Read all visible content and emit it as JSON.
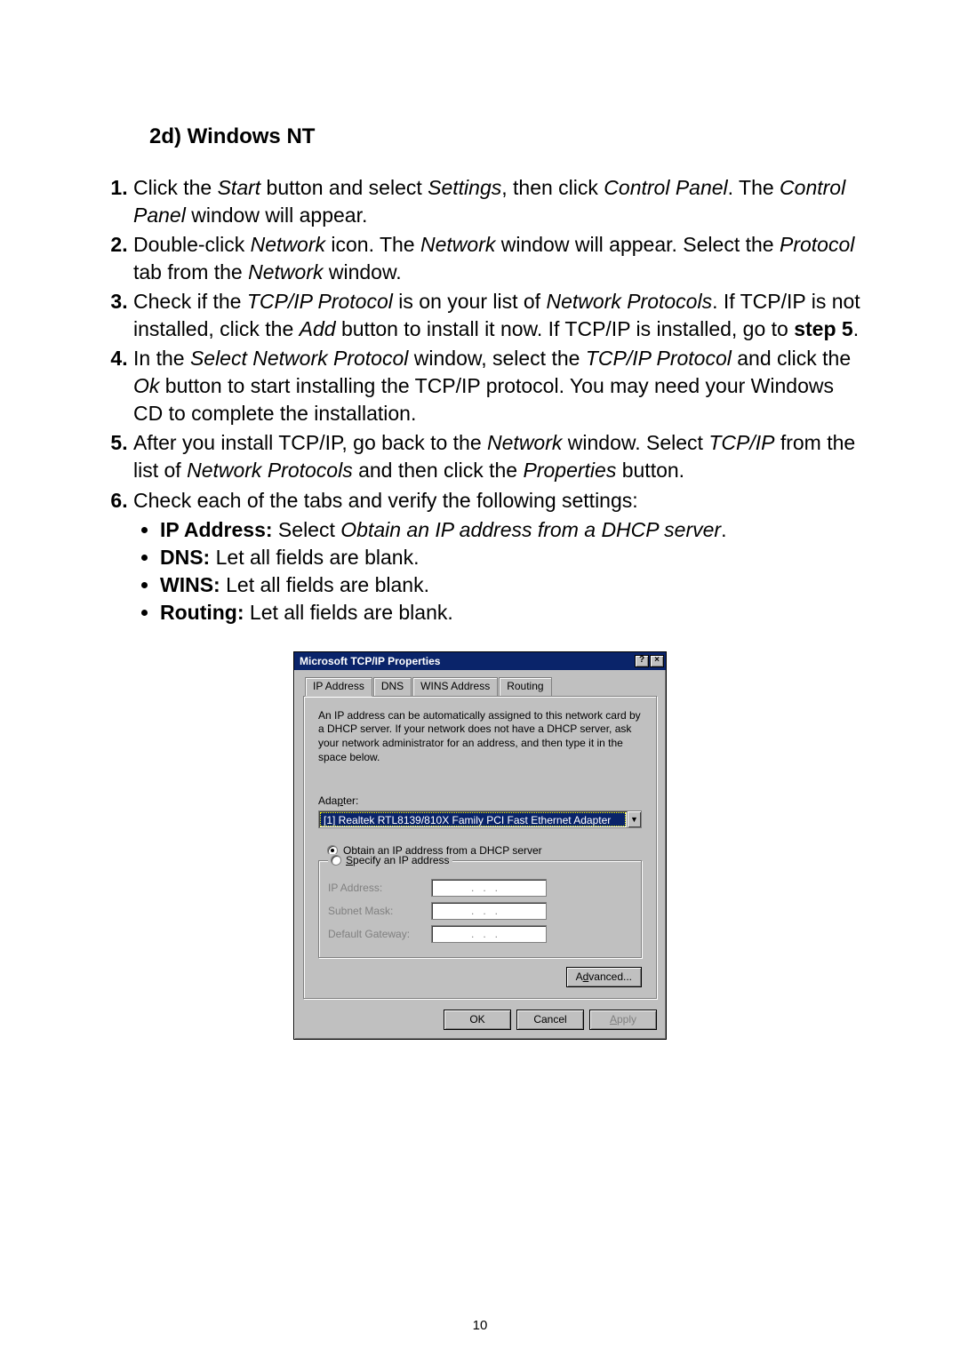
{
  "heading": "2d) Windows NT",
  "steps": {
    "1": {
      "pre": "Click the ",
      "i1": "Start",
      "mid1": " button and select ",
      "i2": "Settings",
      "mid2": ", then click ",
      "i3": "Control Panel",
      "mid3": ". The ",
      "i4": "Control Panel",
      "post": " window will appear."
    },
    "2": {
      "pre": "Double-click ",
      "i1": "Network",
      "mid1": " icon. The ",
      "i2": "Network",
      "mid2": " window will appear. Select the ",
      "i3": "Protocol",
      "mid3": " tab from the ",
      "i4": "Network",
      "post": " window."
    },
    "3": {
      "pre": "Check if the ",
      "i1": "TCP/IP Protocol",
      "mid1": " is on your list of ",
      "i2": "Network Protocols",
      "mid2": ". If TCP/IP is not installed, click the ",
      "i3": "Add",
      "mid3": " button to install it now. If TCP/IP is installed, go to ",
      "b1": "step 5",
      "post": "."
    },
    "4": {
      "pre": "In the ",
      "i1": "Select Network Protocol",
      "mid1": " window, select the ",
      "i2": "TCP/IP Protocol",
      "mid2": " and click the ",
      "i3": "Ok",
      "post": " button to start installing the TCP/IP protocol. You may need your Windows CD to complete the installation."
    },
    "5": {
      "pre": "After you install TCP/IP, go back to the ",
      "i1": "Network",
      "mid1": " window. Select ",
      "i2": "TCP/IP",
      "mid2": " from the list of ",
      "i3": "Network Protocols",
      "mid3": " and then click the ",
      "i4": "Properties",
      "post": " button."
    },
    "6": {
      "text": "Check each of the tabs and verify the following settings:",
      "bullets": {
        "0": {
          "b": "IP Address:",
          "mid": " Select ",
          "i": "Obtain an IP address from a DHCP server",
          "post": "."
        },
        "1": {
          "b": "DNS:",
          "post": " Let all fields are blank."
        },
        "2": {
          "b": "WINS:",
          "post": " Let all fields are blank."
        },
        "3": {
          "b": "Routing:",
          "post": " Let all fields are blank."
        }
      }
    }
  },
  "dialog": {
    "title": "Microsoft TCP/IP Properties",
    "help_glyph": "?",
    "close_glyph": "×",
    "tabs": {
      "0": "IP Address",
      "1": "DNS",
      "2": "WINS Address",
      "3": "Routing"
    },
    "description": "An IP address can be automatically assigned to this network card by a DHCP server.  If your network does not have a DHCP server, ask your network administrator for an address, and then type it in the space below.",
    "adapter_label": "Adapter:",
    "adapter_value": "[1] Realtek RTL8139/810X Family PCI Fast Ethernet Adapter",
    "drop_glyph": "▼",
    "radio_obtain": "Obtain an IP address from a DHCP server",
    "radio_specify": "Specify an IP address",
    "fields": {
      "ip": "IP Address:",
      "mask": "Subnet Mask:",
      "gw": "Default Gateway:"
    },
    "ip_placeholder": "...",
    "advanced": "Advanced...",
    "ok": "OK",
    "cancel": "Cancel",
    "apply": "Apply"
  },
  "page_number": "10"
}
